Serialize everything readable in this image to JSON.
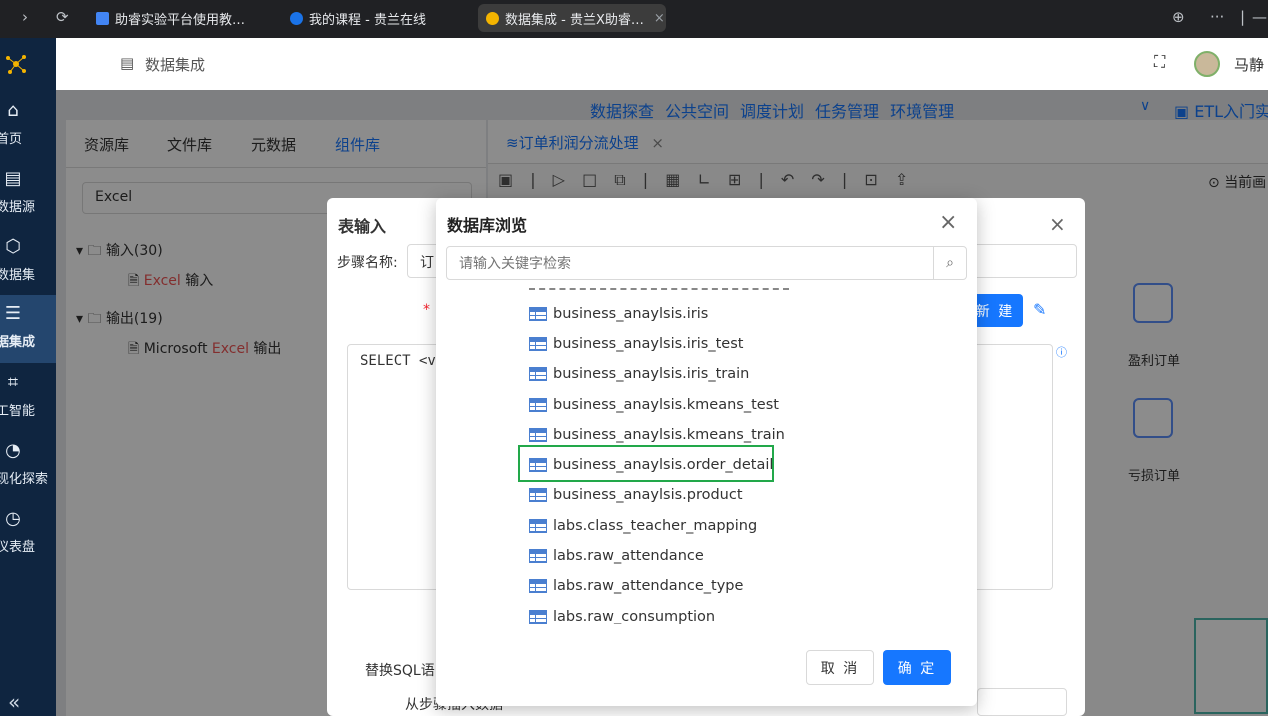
{
  "browser": {
    "tabs": [
      {
        "title": "助睿实验平台使用教…",
        "color": "#4285f4"
      },
      {
        "title": "我的课程 - 贵兰在线",
        "color": "#1a73e8"
      },
      {
        "title": "数据集成 - 贵兰X助睿…",
        "color": "#f4b400"
      }
    ]
  },
  "sidebar": {
    "items": [
      {
        "label": "首页",
        "icon": "home-icon"
      },
      {
        "label": "数据源",
        "icon": "database-icon"
      },
      {
        "label": "数据集",
        "icon": "cube-icon"
      },
      {
        "label": "据集成",
        "icon": "server-icon"
      },
      {
        "label": "工智能",
        "icon": "ai-icon"
      },
      {
        "label": "现化探索",
        "icon": "pie-chart-icon"
      },
      {
        "label": "仪表盘",
        "icon": "gauge-icon"
      }
    ],
    "collapse": "«"
  },
  "header": {
    "title": "数据集成",
    "user": "马静",
    "fullscreen": "⛶"
  },
  "topnav": {
    "items": [
      "数据探查",
      "公共空间",
      "调度计划",
      "任务管理",
      "环境管理"
    ],
    "etl": "ETL入门实"
  },
  "lefttabs": [
    "资源库",
    "文件库",
    "元数据",
    "组件库"
  ],
  "search": {
    "value": "Excel"
  },
  "tree": {
    "input_group": "输入(30)",
    "input_item_hl": "Excel",
    "input_item_rest": " 输入",
    "output_group": "输出(19)",
    "output_item_pre": "Microsoft ",
    "output_item_hl": "Excel",
    "output_item_rest": " 输出"
  },
  "editor": {
    "tab": "订单利润分流处理",
    "right_label": "当前画",
    "node1": "盈利订单",
    "node2": "亏损订单"
  },
  "tableinput": {
    "title": "表输入",
    "step_label": "步骤名称:",
    "step_value": "订",
    "sql": "SELECT <va",
    "new_btn": "新 建",
    "replace_label": "替换SQL语",
    "from_step": "从步骤插入数据"
  },
  "dialog": {
    "title": "数据库浏览",
    "search_placeholder": "请输入关键字检索",
    "items": [
      "business_anaylsis.iris",
      "business_anaylsis.iris_test",
      "business_anaylsis.iris_train",
      "business_anaylsis.kmeans_test",
      "business_anaylsis.kmeans_train",
      "business_anaylsis.order_detail",
      "business_anaylsis.product",
      "labs.class_teacher_mapping",
      "labs.raw_attendance",
      "labs.raw_attendance_type",
      "labs.raw_consumption"
    ],
    "cancel": "取 消",
    "confirm": "确 定"
  }
}
